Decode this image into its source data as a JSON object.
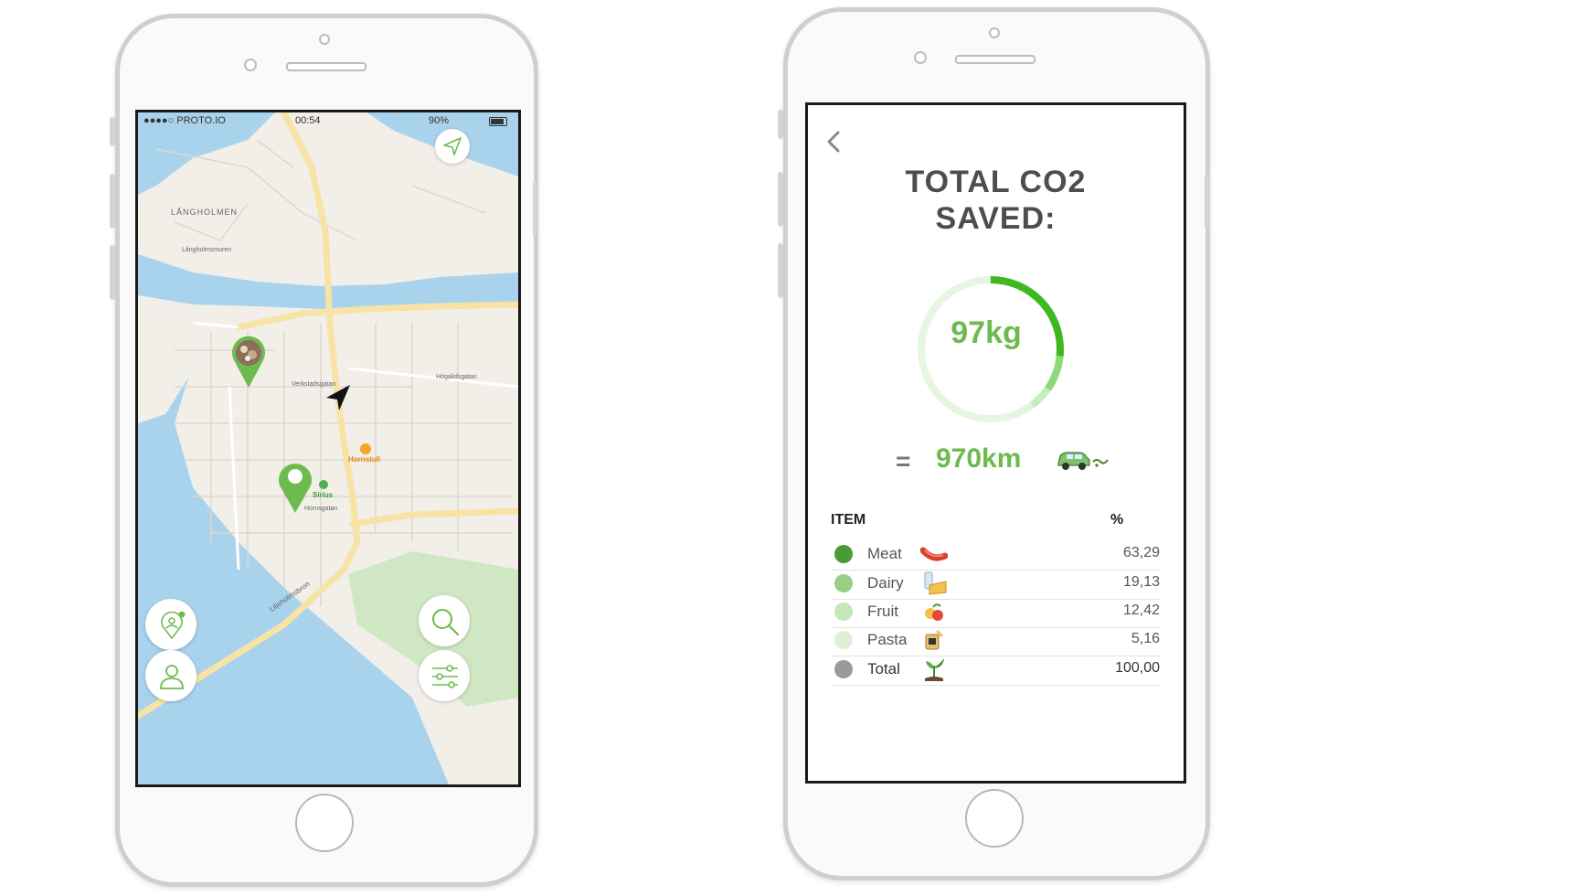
{
  "left_phone": {
    "status_bar": {
      "carrier": "●●●●○ PROTO.IO",
      "time": "00:54",
      "battery": "90%"
    },
    "map": {
      "labels": {
        "langholmen": "LÅNGHOLMEN",
        "langholmsmuren": "Långholmsmuren",
        "verkstadsgatan": "Verkstadsgatan",
        "hogalidsgatan": "Högalidsgatan",
        "hornsgatan": "Hornsgatan",
        "liljeholmsbron": "Liljeholmsbron"
      },
      "pois": {
        "hornstull": "Hornstull",
        "sirius": "Sirius"
      }
    },
    "buttons": {
      "locate": "navigation-arrow-icon",
      "nearby": "location-person-icon",
      "profile": "user-icon",
      "search": "search-icon",
      "filters": "sliders-icon"
    }
  },
  "right_phone": {
    "back_icon": "chevron-left-icon",
    "title_line1": "TOTAL CO2",
    "title_line2": "SAVED:",
    "donut": {
      "value_label": "97kg",
      "segments": [
        63.29,
        19.13,
        12.42,
        5.16
      ],
      "colors": [
        "#3fb81f",
        "#8ed97a",
        "#c7ecbd",
        "#e3f5dd"
      ]
    },
    "equivalent": {
      "equals": "=",
      "distance": "970km",
      "icon": "car-icon"
    },
    "table": {
      "header_item": "ITEM",
      "header_pct": "%",
      "rows": [
        {
          "name": "Meat",
          "value": "63,29",
          "color": "#4a9b36",
          "icon": "sausage-icon"
        },
        {
          "name": "Dairy",
          "value": "19,13",
          "color": "#98cf86",
          "icon": "dairy-icon"
        },
        {
          "name": "Fruit",
          "value": "12,42",
          "color": "#c4e8b9",
          "icon": "fruit-icon"
        },
        {
          "name": "Pasta",
          "value": "5,16",
          "color": "#dcf1d4",
          "icon": "pasta-icon"
        },
        {
          "name": "Total",
          "value": "100,00",
          "color": "#9a9a9a",
          "icon": "sprout-icon"
        }
      ]
    }
  }
}
